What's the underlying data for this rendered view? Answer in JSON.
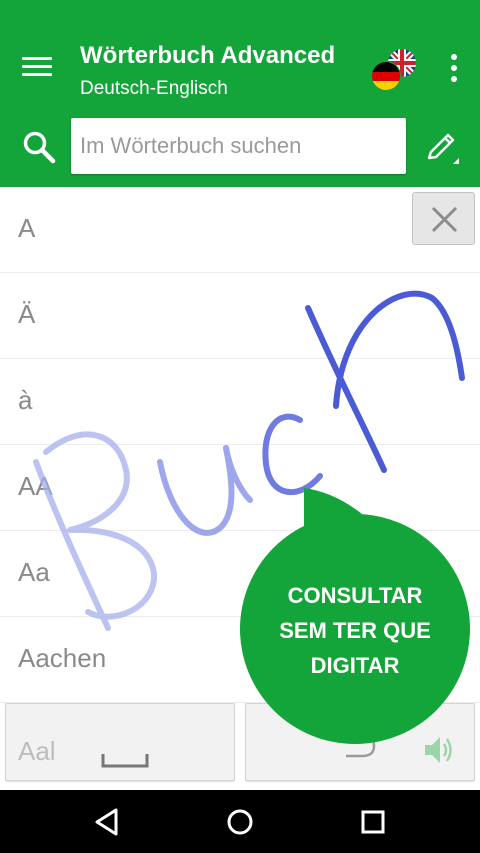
{
  "appbar": {
    "title": "Wörterbuch Advanced",
    "subtitle": "Deutsch-Englisch",
    "color": "#14a53a"
  },
  "search": {
    "placeholder": "Im Wörterbuch suchen",
    "value": ""
  },
  "list": {
    "items": [
      "A",
      "Ä",
      "à",
      "AA",
      "Aa",
      "Aachen"
    ]
  },
  "handwriting": {
    "word": "Buch",
    "color": "#4b5bd6"
  },
  "fab": {
    "label": "CONSULTAR\nSEM TER QUE\nDIGITAR",
    "color": "#14a53a"
  },
  "keyboard": {
    "peek_word": "Aal"
  },
  "icons": {
    "menu": "menu-icon",
    "flags": "german-english-flag-icon",
    "overflow": "more-vert-icon",
    "search": "search-icon",
    "handwriting": "pen-icon",
    "clear": "close-icon",
    "space": "space-bar-icon",
    "enter": "enter-icon",
    "speaker": "speaker-icon",
    "back": "back-icon",
    "home": "home-icon",
    "recents": "recents-icon"
  }
}
